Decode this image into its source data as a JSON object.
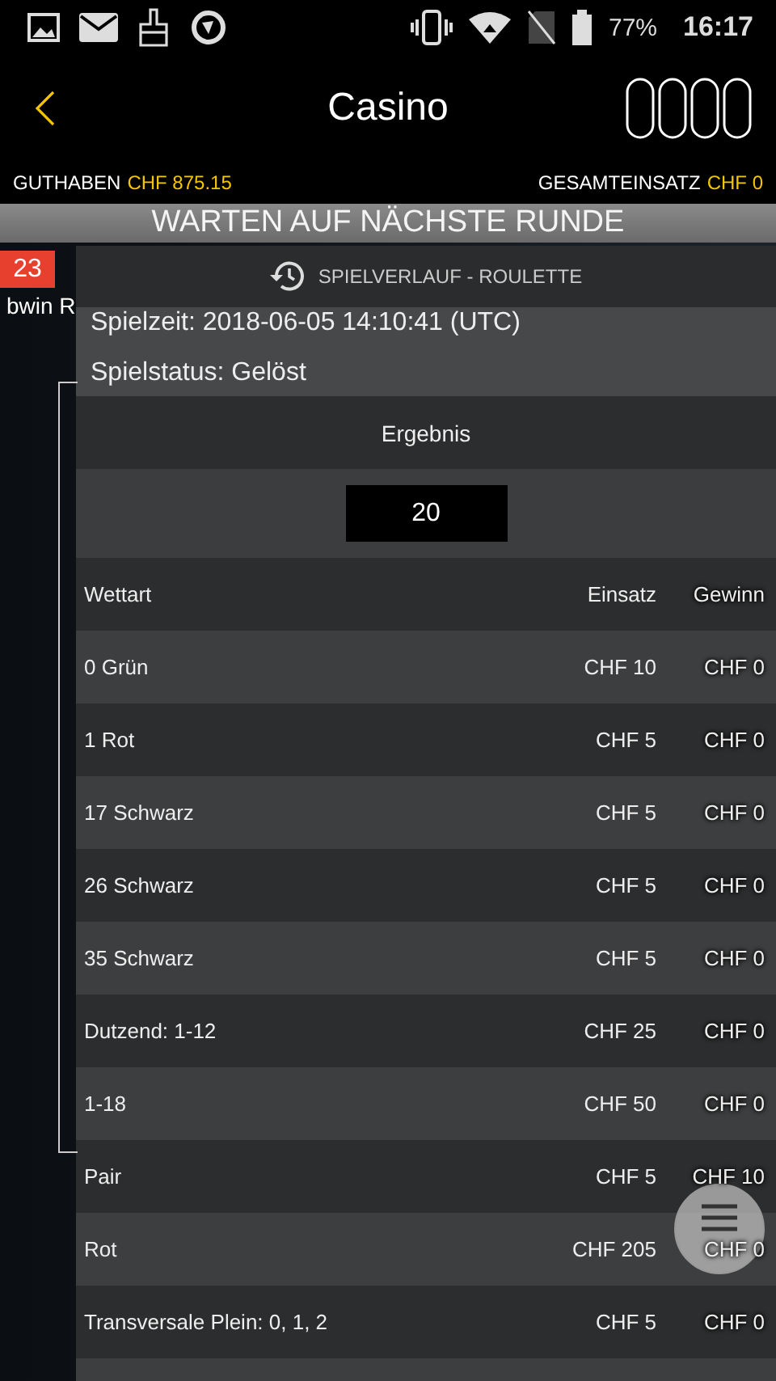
{
  "status_bar": {
    "battery": "77%",
    "time": "16:17"
  },
  "header": {
    "title": "Casino"
  },
  "balances": [
    {
      "label": "GUTHABEN",
      "value": "CHF 875.15"
    },
    {
      "label": "GESAMTEINSATZ",
      "value": "CHF 0"
    }
  ],
  "banner": "WARTEN AUF NÄCHSTE RUNDE",
  "table_strip": {
    "last_number": "23",
    "game_label": "bwin R"
  },
  "history": {
    "title": "SPIELVERLAUF - ROULETTE",
    "info": [
      "Spielzeit: 2018-06-05 14:10:41 (UTC)",
      "Spielstatus: Gelöst"
    ],
    "result_label": "Ergebnis",
    "result": "20",
    "columns": [
      "Wettart",
      "Einsatz",
      "Gewinn"
    ],
    "rows": [
      {
        "bet": "0 Grün",
        "stake": "CHF 10",
        "win": "CHF 0"
      },
      {
        "bet": "1 Rot",
        "stake": "CHF 5",
        "win": "CHF 0"
      },
      {
        "bet": "17 Schwarz",
        "stake": "CHF 5",
        "win": "CHF 0"
      },
      {
        "bet": "26 Schwarz",
        "stake": "CHF 5",
        "win": "CHF 0"
      },
      {
        "bet": "35 Schwarz",
        "stake": "CHF 5",
        "win": "CHF 0"
      },
      {
        "bet": "Dutzend: 1-12",
        "stake": "CHF 25",
        "win": "CHF 0"
      },
      {
        "bet": "1-18",
        "stake": "CHF 50",
        "win": "CHF 0"
      },
      {
        "bet": "Pair",
        "stake": "CHF 5",
        "win": "CHF 10"
      },
      {
        "bet": "Rot",
        "stake": "CHF 205",
        "win": "CHF 0"
      },
      {
        "bet": "Transversale Plein: 0, 1, 2",
        "stake": "CHF 5",
        "win": "CHF 0"
      }
    ]
  }
}
